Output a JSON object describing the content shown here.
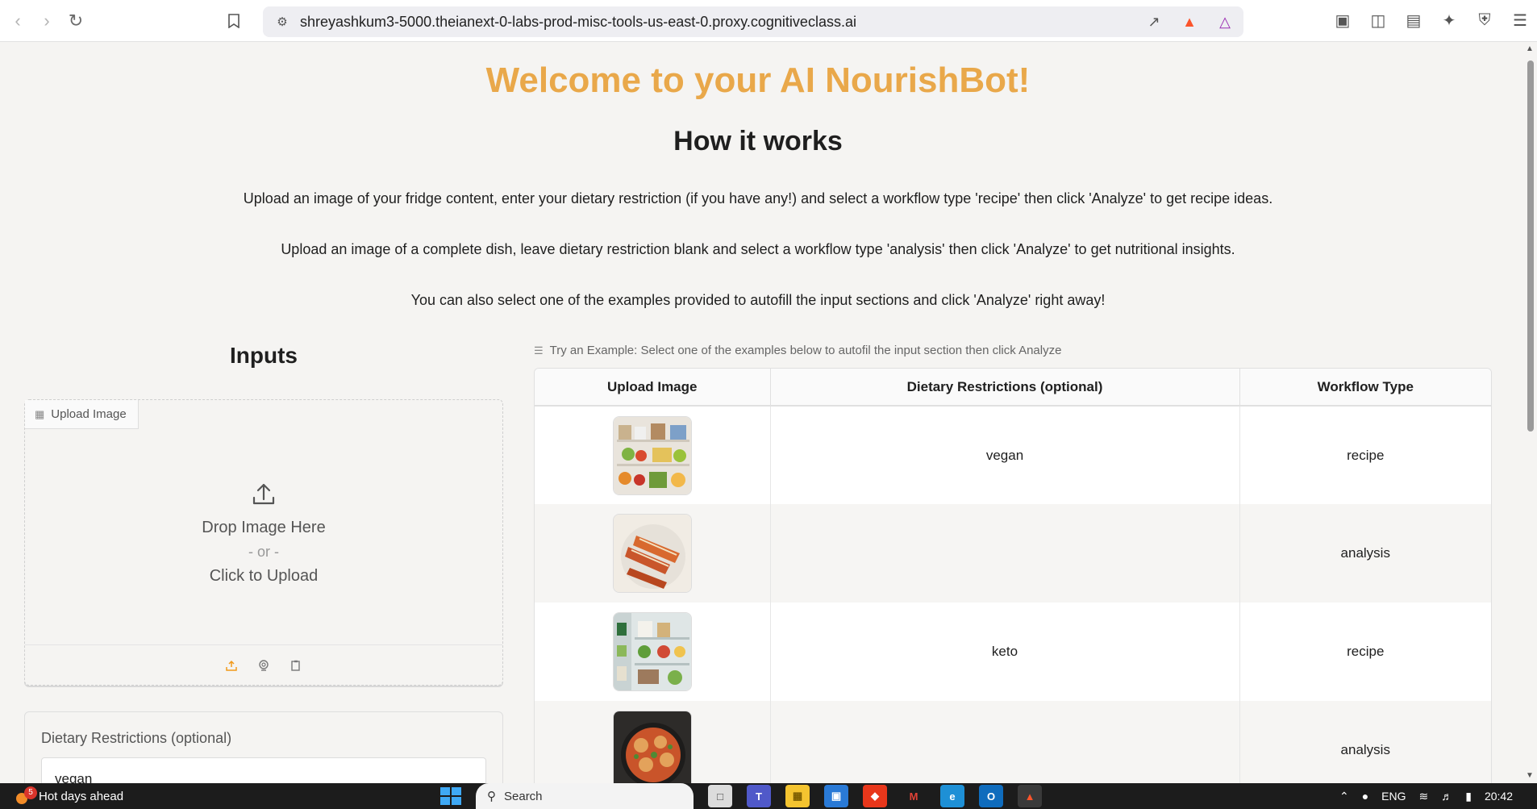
{
  "browser": {
    "url": "shreyashkum3-5000.theianext-0-labs-prod-misc-tools-us-east-0.proxy.cognitiveclass.ai"
  },
  "page": {
    "title": "Welcome to your AI NourishBot!",
    "subtitle": "How it works",
    "paragraphs": [
      "Upload an image of your fridge content, enter your dietary restriction (if you have any!) and select a workflow type 'recipe' then click 'Analyze' to get recipe ideas.",
      "Upload an image of a complete dish, leave dietary restriction blank and select a workflow type 'analysis' then click 'Analyze' to get nutritional insights.",
      "You can also select one of the examples provided to autofill the input sections and click 'Analyze' right away!"
    ]
  },
  "inputs": {
    "heading": "Inputs",
    "upload": {
      "tab_label": "Upload Image",
      "drop_text": "Drop Image Here",
      "or_text": "- or -",
      "click_text": "Click to Upload"
    },
    "dietary": {
      "label": "Dietary Restrictions (optional)",
      "value": "vegan"
    }
  },
  "examples": {
    "label": "Try an Example: Select one of the examples below to autofil the input section then click Analyze",
    "columns": [
      "Upload Image",
      "Dietary Restrictions (optional)",
      "Workflow Type"
    ],
    "rows": [
      {
        "image": "fridge-image",
        "diet": "vegan",
        "workflow": "recipe"
      },
      {
        "image": "dish-image",
        "diet": "",
        "workflow": "analysis"
      },
      {
        "image": "fridge-image",
        "diet": "keto",
        "workflow": "recipe"
      },
      {
        "image": "dish-image",
        "diet": "",
        "workflow": "analysis"
      }
    ]
  },
  "taskbar": {
    "weather_count": "5",
    "weather_text": "Hot days ahead",
    "search_placeholder": "Search",
    "language": "ENG",
    "time": "20:42"
  }
}
